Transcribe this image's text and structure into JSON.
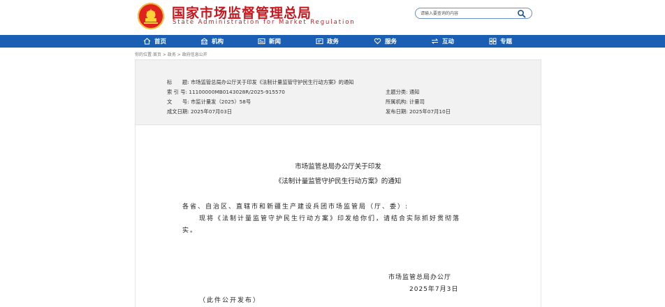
{
  "header": {
    "site_title": "国家市场监督管理总局",
    "site_subtitle": "State Administration for Market Regulation",
    "search_placeholder": "请输入要查询的内容"
  },
  "nav": {
    "items": [
      {
        "label": "首页",
        "icon": "home-icon"
      },
      {
        "label": "机构",
        "icon": "building-icon"
      },
      {
        "label": "新闻",
        "icon": "newspaper-icon"
      },
      {
        "label": "政务",
        "icon": "government-icon"
      },
      {
        "label": "服务",
        "icon": "heart-icon"
      },
      {
        "label": "互动",
        "icon": "exchange-icon"
      },
      {
        "label": "专题",
        "icon": "grid-icon"
      }
    ]
  },
  "breadcrumb": "你的位置:首页 > 政务 > 政府信息公开",
  "meta": {
    "title_label": "标　　题:",
    "title_value": "市场监管总局办公厅关于印发《法制计量监管守护民生行动方案》的通知",
    "index_label": "索 引 号:",
    "index_value": "11100000MB0143028R/2025-915570",
    "category_label": "主题分类:",
    "category_value": "通知",
    "docno_label": "文　　号:",
    "docno_value": "市监计量发（2025）58号",
    "org_label": "所属机构:",
    "org_value": "计量司",
    "created_label": "成文日期:",
    "created_value": "2025年07月03日",
    "published_label": "发布日期:",
    "published_value": "2025年07月10日"
  },
  "document": {
    "title_line1": "市场监管总局办公厅关于印发",
    "title_line2": "《法制计量监管守护民生行动方案》的通知",
    "salutation": "各省、自治区、直辖市和新疆生产建设兵团市场监管局（厅、委）:",
    "body_line1": "现将《法制计量监管守护民生行动方案》印发给你们，请结合实际抓好贯彻落",
    "body_line2": "实。",
    "signature": "市场监管总局办公厅",
    "date": "2025年7月3日",
    "footer_note": "（此件公开发布）"
  },
  "colors": {
    "brand_red": "#c8161d",
    "nav_blue": "#1a5fb4"
  }
}
